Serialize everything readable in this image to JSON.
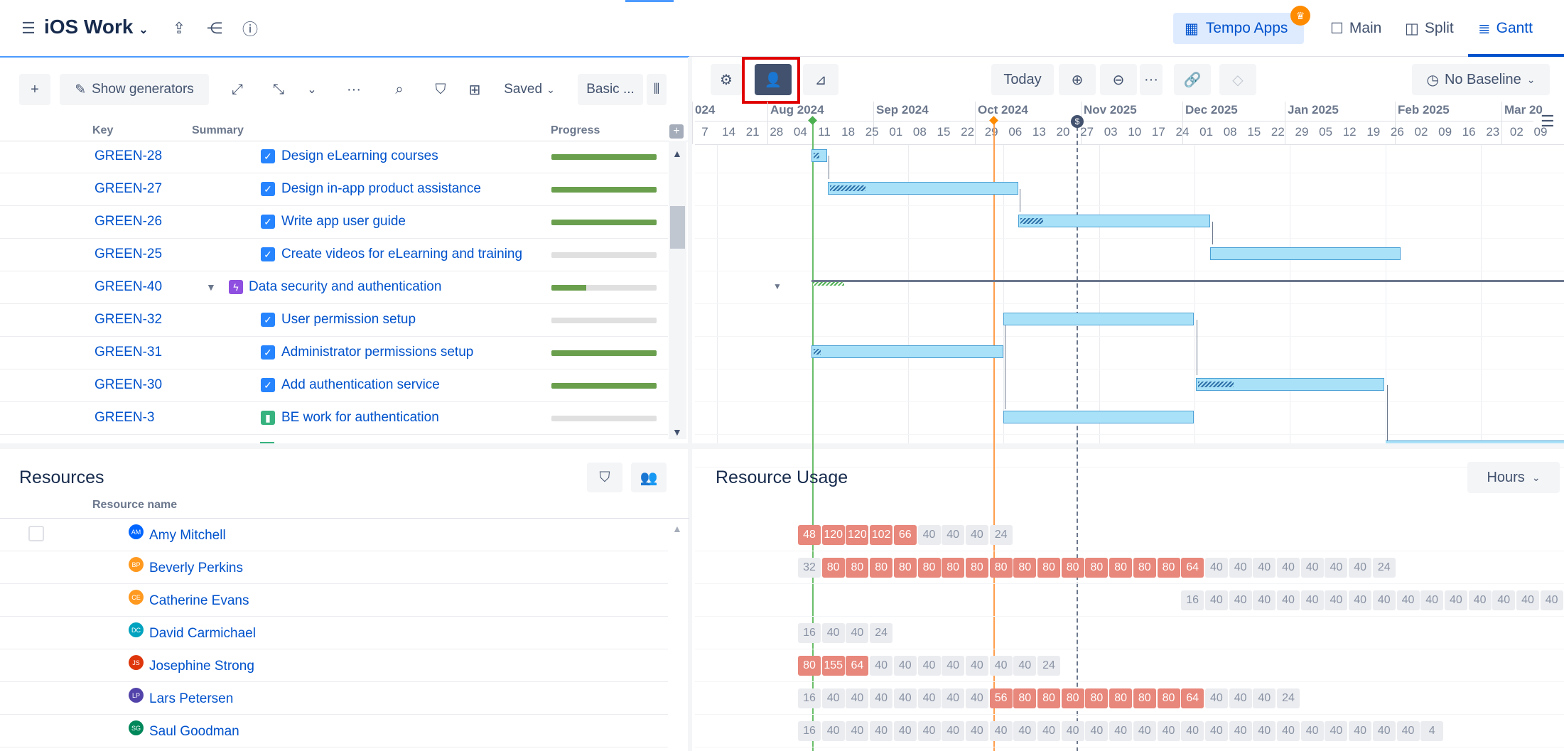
{
  "header": {
    "project_title": "iOS Work",
    "tempo_apps": "Tempo Apps",
    "views": [
      "Main",
      "Split",
      "Gantt"
    ]
  },
  "toolbar": {
    "show_generators": "Show generators",
    "saved": "Saved",
    "basic": "Basic ..."
  },
  "gantt_toolbar": {
    "today": "Today",
    "no_baseline": "No Baseline"
  },
  "columns": {
    "key": "Key",
    "summary": "Summary",
    "progress": "Progress"
  },
  "issues": [
    {
      "key": "GREEN-28",
      "summary": "Design eLearning courses",
      "type": "task",
      "progress": 1.0
    },
    {
      "key": "GREEN-27",
      "summary": "Design in-app product assistance",
      "type": "task",
      "progress": 1.0
    },
    {
      "key": "GREEN-26",
      "summary": "Write app user guide",
      "type": "task",
      "progress": 1.0
    },
    {
      "key": "GREEN-25",
      "summary": "Create videos for eLearning and training",
      "type": "task",
      "progress": 0.0
    },
    {
      "key": "GREEN-40",
      "summary": "Data security and authentication",
      "type": "epic",
      "progress": 0.33
    },
    {
      "key": "GREEN-32",
      "summary": "User permission setup",
      "type": "task",
      "progress": 0.0
    },
    {
      "key": "GREEN-31",
      "summary": "Administrator permissions setup",
      "type": "task",
      "progress": 1.0
    },
    {
      "key": "GREEN-30",
      "summary": "Add authentication service",
      "type": "task",
      "progress": 1.0
    },
    {
      "key": "GREEN-3",
      "summary": "BE work for authentication",
      "type": "story",
      "progress": 0.0
    }
  ],
  "timeline": {
    "months": [
      "024",
      "Aug 2024",
      "Sep 2024",
      "Oct 2024",
      "Nov 2025",
      "Dec 2025",
      "Jan 2025",
      "Feb 2025",
      "Mar 20"
    ],
    "days": [
      "7",
      "14",
      "21",
      "28",
      "04",
      "11",
      "18",
      "25",
      "01",
      "08",
      "15",
      "22",
      "29",
      "06",
      "13",
      "20",
      "27",
      "03",
      "10",
      "17",
      "24",
      "01",
      "08",
      "15",
      "22",
      "29",
      "05",
      "12",
      "19",
      "26",
      "02",
      "09",
      "16",
      "23",
      "02",
      "09"
    ]
  },
  "resources": {
    "title": "Resources",
    "column": "Resource name",
    "usage_title": "Resource Usage",
    "unit": "Hours",
    "people": [
      {
        "name": "Amy Mitchell",
        "initials": "AM",
        "color": "#0065ff",
        "start": 0,
        "values": [
          48,
          120,
          120,
          102,
          66,
          40,
          40,
          40,
          24
        ]
      },
      {
        "name": "Beverly Perkins",
        "initials": "BP",
        "color": "#ff991f",
        "start": 0,
        "values": [
          32,
          80,
          80,
          80,
          80,
          80,
          80,
          80,
          80,
          80,
          80,
          80,
          80,
          80,
          80,
          80,
          64,
          40,
          40,
          40,
          40,
          40,
          40,
          40,
          24
        ]
      },
      {
        "name": "Catherine Evans",
        "initials": "CE",
        "color": "#ff991f",
        "start": 16,
        "values": [
          16,
          40,
          40,
          40,
          40,
          40,
          40,
          40,
          40,
          40,
          40,
          40,
          40,
          40,
          40,
          40
        ]
      },
      {
        "name": "David Carmichael",
        "initials": "DC",
        "color": "#00a3bf",
        "start": 0,
        "values": [
          16,
          40,
          40,
          24
        ]
      },
      {
        "name": "Josephine Strong",
        "initials": "JS",
        "color": "#de350b",
        "start": 0,
        "values": [
          80,
          155,
          64,
          40,
          40,
          40,
          40,
          40,
          40,
          40,
          24
        ]
      },
      {
        "name": "Lars Petersen",
        "initials": "LP",
        "color": "#5243aa",
        "start": 0,
        "values": [
          16,
          40,
          40,
          40,
          40,
          40,
          40,
          40,
          56,
          80,
          80,
          80,
          80,
          80,
          80,
          80,
          64,
          40,
          40,
          40,
          24
        ]
      },
      {
        "name": "Saul Goodman",
        "initials": "SG",
        "color": "#00875a",
        "start": 0,
        "values": [
          16,
          40,
          40,
          40,
          40,
          40,
          40,
          40,
          40,
          40,
          40,
          40,
          40,
          40,
          40,
          40,
          40,
          40,
          40,
          40,
          40,
          40,
          40,
          40,
          40,
          40,
          4
        ]
      }
    ]
  }
}
